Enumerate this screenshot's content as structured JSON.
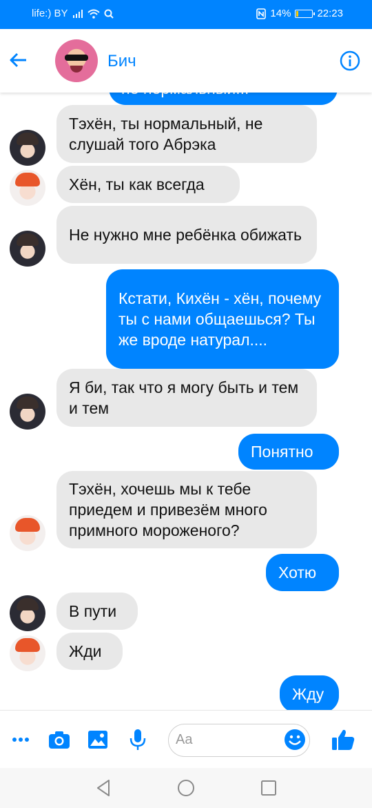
{
  "status_bar": {
    "carrier": "life:) BY",
    "battery_text": "14%",
    "battery_level": 0.14,
    "time": "22:23"
  },
  "header": {
    "contact_name": "Бич",
    "back_icon": "arrow-left-icon",
    "info_icon": "info-circle-icon"
  },
  "messages": [
    {
      "id": "m0",
      "direction": "out",
      "text": "не нормальный..."
    },
    {
      "id": "m1",
      "direction": "in",
      "sender": "dark",
      "text": "Тэхён, ты нормальный, не слушай того Абрэка"
    },
    {
      "id": "m2",
      "direction": "in",
      "sender": "red",
      "text": "Хён, ты как всегда"
    },
    {
      "id": "m3",
      "direction": "in",
      "sender": "dark",
      "text": "Не нужно мне ребёнка обижать"
    },
    {
      "id": "m4",
      "direction": "out",
      "text": "Кстати, Кихён - хён, почему ты с нами общаешься? Ты же вроде натурал...."
    },
    {
      "id": "m5",
      "direction": "in",
      "sender": "dark",
      "text": "Я би, так что я могу быть и тем и тем"
    },
    {
      "id": "m6",
      "direction": "out",
      "text": "Понятно"
    },
    {
      "id": "m7",
      "direction": "in",
      "sender": "red",
      "text": "Тэхён, хочешь мы к тебе приедем и привезём много примного мороженого?"
    },
    {
      "id": "m8",
      "direction": "out",
      "text": "Хотю"
    },
    {
      "id": "m9",
      "direction": "in",
      "sender": "dark",
      "text": "В пути"
    },
    {
      "id": "m10",
      "direction": "in",
      "sender": "red",
      "text": "Жди"
    },
    {
      "id": "m11",
      "direction": "out",
      "text": "Жду"
    }
  ],
  "composer": {
    "placeholder": "Aa",
    "icons": [
      "more-icon",
      "camera-icon",
      "gallery-icon",
      "microphone-icon",
      "emoji-icon",
      "thumbs-up-icon"
    ]
  },
  "nav_bar": {
    "icons": [
      "back-triangle-icon",
      "home-circle-icon",
      "recents-square-icon"
    ]
  },
  "colors": {
    "accent": "#0084ff",
    "incoming_bubble": "#e8e8e8",
    "outgoing_text": "#ffffff"
  }
}
